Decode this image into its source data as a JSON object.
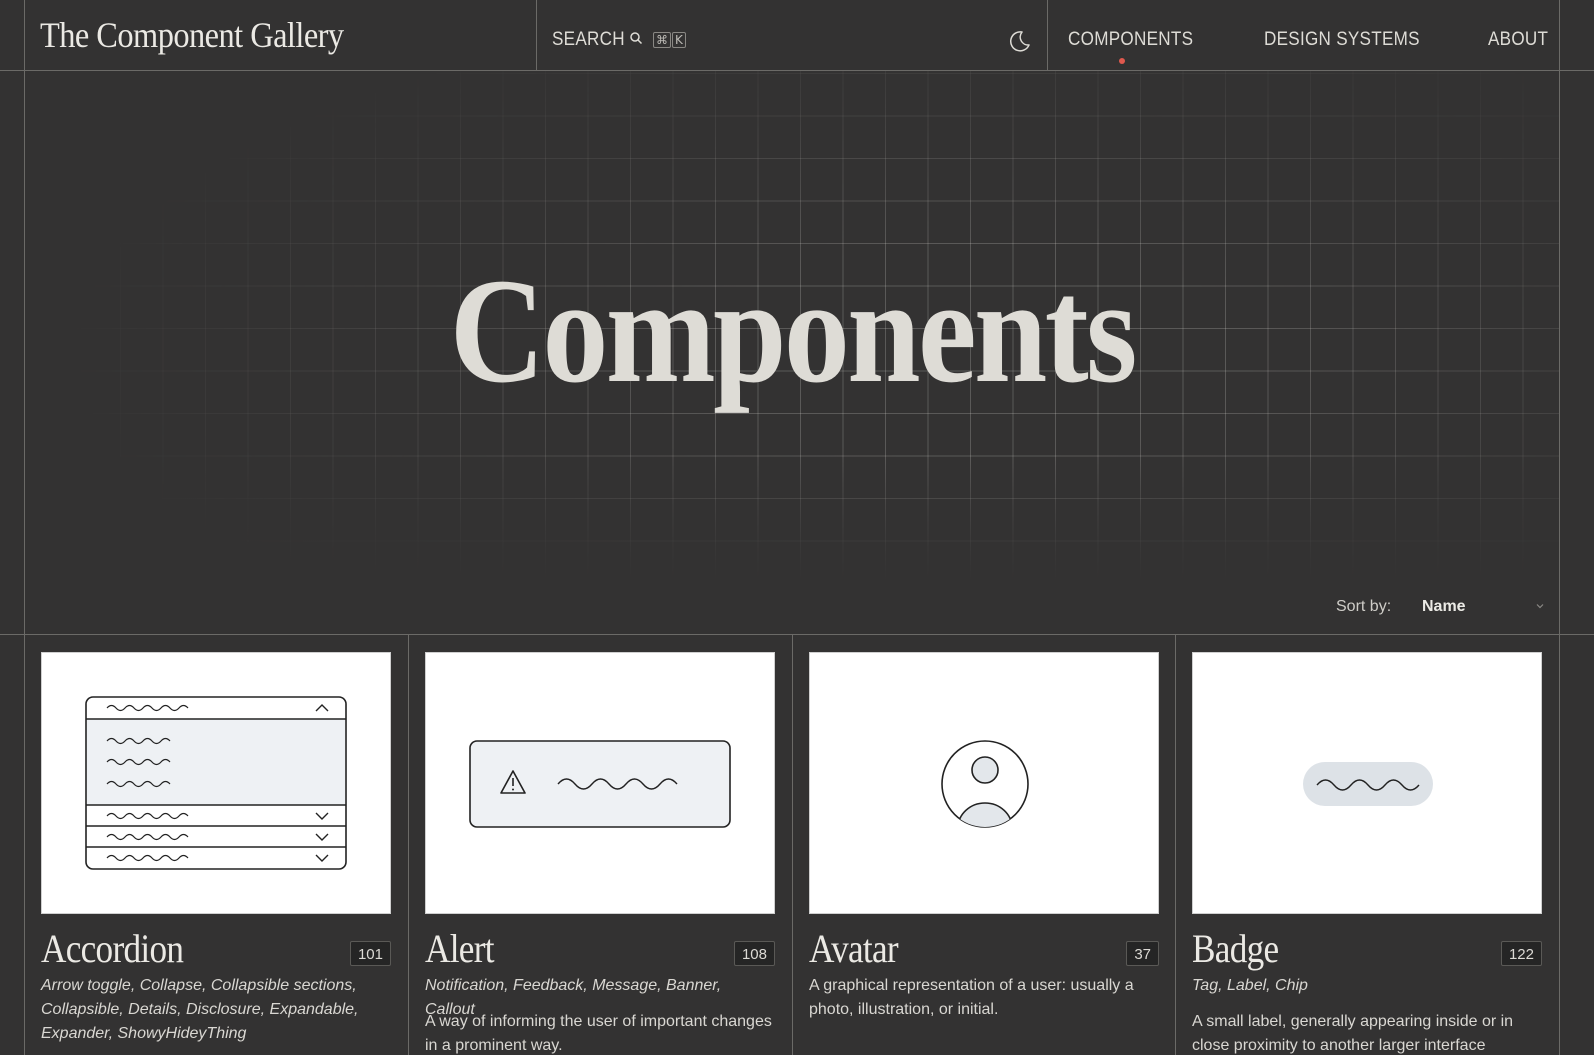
{
  "header": {
    "logo": "The Component Gallery",
    "search_label": "SEARCH",
    "shortcut_keys": [
      "⌘",
      "K"
    ],
    "nav": [
      {
        "label": "COMPONENTS",
        "active": true
      },
      {
        "label": "DESIGN SYSTEMS",
        "active": false
      },
      {
        "label": "ABOUT",
        "active": false
      }
    ],
    "accent_color": "#e0594e"
  },
  "hero": {
    "title": "Components"
  },
  "sort": {
    "label": "Sort by:",
    "value": "Name"
  },
  "cards": [
    {
      "title": "Accordion",
      "count": "101",
      "aliases": "Arrow toggle, Collapse, Collapsible sections, Collapsible, Details, Disclosure, Expandable, Expander, ShowyHideyThing",
      "description": ""
    },
    {
      "title": "Alert",
      "count": "108",
      "aliases": "Notification, Feedback, Message, Banner, Callout",
      "description": "A way of informing the user of important changes in a prominent way."
    },
    {
      "title": "Avatar",
      "count": "37",
      "aliases": "",
      "description": "A graphical representation of a user: usually a photo, illustration, or initial."
    },
    {
      "title": "Badge",
      "count": "122",
      "aliases": "Tag, Label, Chip",
      "description": "A small label, generally appearing inside or in close proximity to another larger interface component,"
    }
  ]
}
